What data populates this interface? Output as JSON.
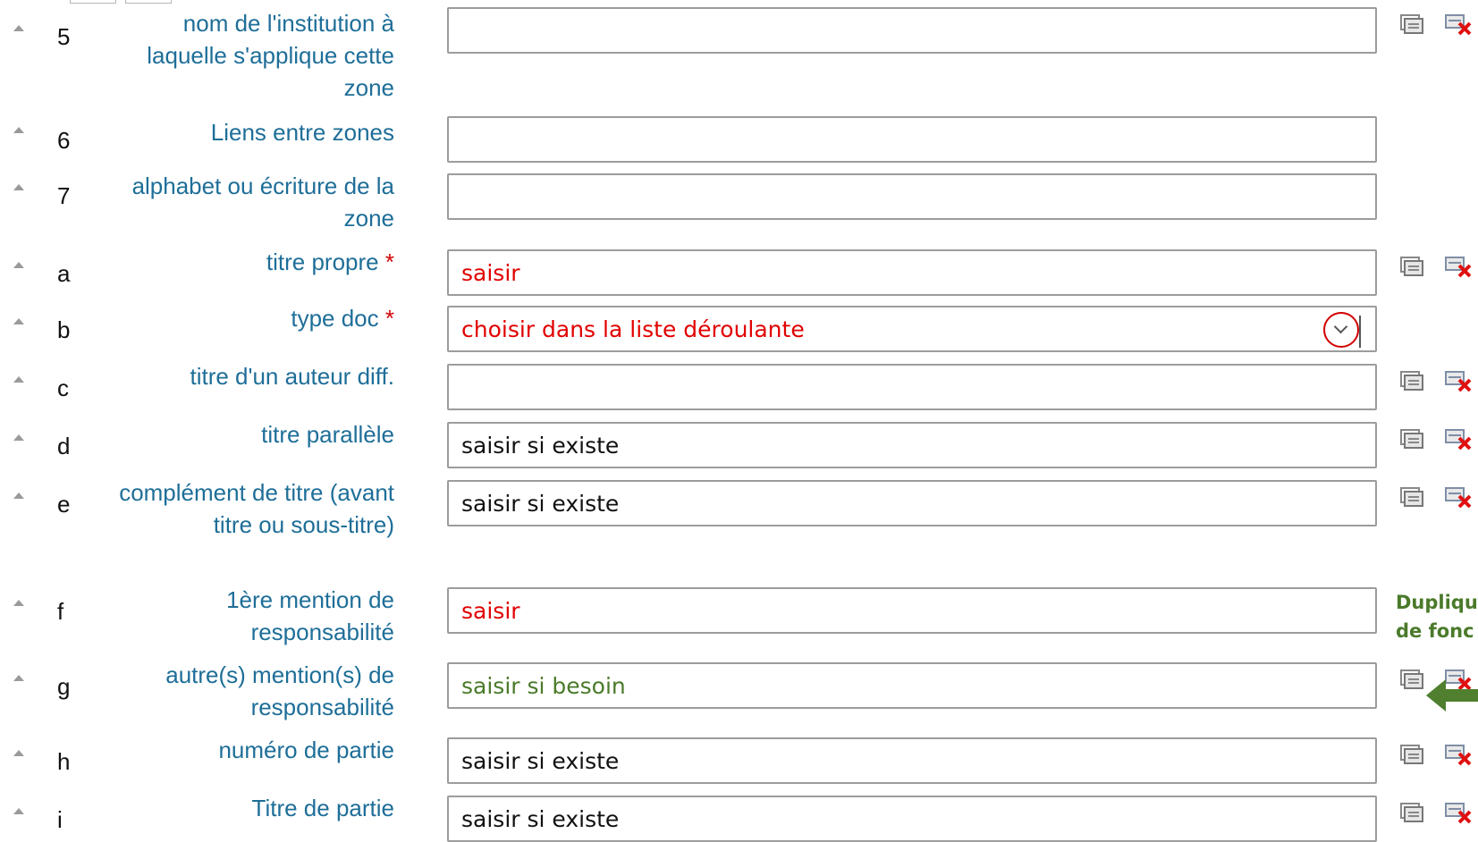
{
  "rows": [
    {
      "code": "5",
      "label": "nom de l'institution à laquelle s'applique cette zone",
      "required": false,
      "value": "",
      "placeholder": "",
      "value_color": "black",
      "type": "text",
      "icons": true
    },
    {
      "code": "6",
      "label": "Liens entre zones",
      "required": false,
      "value": "",
      "placeholder": "",
      "value_color": "black",
      "type": "text",
      "icons": false
    },
    {
      "code": "7",
      "label": "alphabet ou écriture de la zone",
      "required": false,
      "value": "",
      "placeholder": "",
      "value_color": "black",
      "type": "text",
      "icons": false
    },
    {
      "code": "a",
      "label": "titre propre",
      "required": true,
      "value": "saisir",
      "placeholder": "",
      "value_color": "red",
      "type": "text",
      "icons": true
    },
    {
      "code": "b",
      "label": "type doc",
      "required": true,
      "value": "choisir dans la liste déroulante",
      "placeholder": "",
      "value_color": "red",
      "type": "select",
      "icons": false
    },
    {
      "code": "c",
      "label": "titre d'un auteur diff.",
      "required": false,
      "value": "",
      "placeholder": "",
      "value_color": "black",
      "type": "text",
      "icons": true
    },
    {
      "code": "d",
      "label": "titre parallèle",
      "required": false,
      "value": "saisir si existe",
      "placeholder": "",
      "value_color": "black",
      "type": "text",
      "icons": true
    },
    {
      "code": "e",
      "label": "complément de titre (avant titre ou sous-titre)",
      "required": false,
      "value": "saisir si existe",
      "placeholder": "",
      "value_color": "black",
      "type": "text",
      "icons": true
    },
    {
      "code": "f",
      "label": "1ère mention de responsabilité",
      "required": false,
      "value": "saisir",
      "placeholder": "",
      "value_color": "red",
      "type": "text",
      "icons": false
    },
    {
      "code": "g",
      "label": "autre(s) mention(s) de responsabilité",
      "required": false,
      "value": "saisir si besoin",
      "placeholder": "",
      "value_color": "green",
      "type": "text",
      "icons": true
    },
    {
      "code": "h",
      "label": "numéro de partie",
      "required": false,
      "value": "saisir si existe",
      "placeholder": "",
      "value_color": "black",
      "type": "text",
      "icons": true
    },
    {
      "code": "i",
      "label": "Titre de partie",
      "required": false,
      "value": "saisir si existe",
      "placeholder": "",
      "value_color": "black",
      "type": "text",
      "icons": true
    }
  ],
  "required_mark": "*",
  "note": {
    "line1": "Dupliqu",
    "line2": "de fonc"
  },
  "colors": {
    "label": "#1e6e98",
    "required": "#d40000",
    "red_value": "#e10000",
    "green_value": "#4a7a2a",
    "border": "#9c9c9c"
  },
  "icon_names": {
    "duplicate": "duplicate-icon",
    "delete": "delete-icon",
    "sort": "sort-up-icon",
    "dropdown": "chevron-down-icon",
    "annotation_arrow": "arrow-left-icon"
  }
}
